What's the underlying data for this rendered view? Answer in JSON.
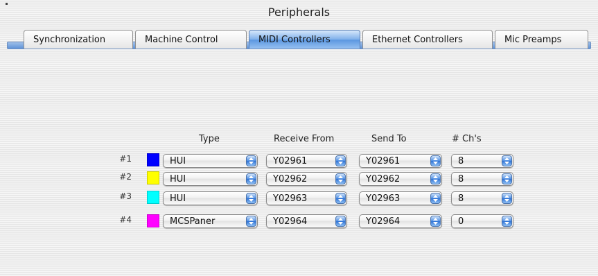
{
  "window": {
    "title": "Peripherals"
  },
  "tabs": [
    {
      "label": "Synchronization",
      "selected": false
    },
    {
      "label": "Machine Control",
      "selected": false
    },
    {
      "label": "MIDI Controllers",
      "selected": true
    },
    {
      "label": "Ethernet Controllers",
      "selected": false
    },
    {
      "label": "Mic Preamps",
      "selected": false
    }
  ],
  "columns": {
    "type": "Type",
    "receive_from": "Receive From",
    "send_to": "Send To",
    "channels": "# Ch's"
  },
  "rows": [
    {
      "label": "#1",
      "color": "#0000ff",
      "type": "HUI",
      "receive_from": "Y02961",
      "send_to": "Y02961",
      "channels": "8"
    },
    {
      "label": "#2",
      "color": "#ffff00",
      "type": "HUI",
      "receive_from": "Y02962",
      "send_to": "Y02962",
      "channels": "8"
    },
    {
      "label": "#3",
      "color": "#00ffff",
      "type": "HUI",
      "receive_from": "Y02963",
      "send_to": "Y02963",
      "channels": "8"
    },
    {
      "label": "#4",
      "color": "#ff00ff",
      "type": "MCSPaner",
      "receive_from": "Y02964",
      "send_to": "Y02964",
      "channels": "0"
    }
  ],
  "icons": {
    "stepper": "up-down-arrows-icon",
    "corner": "window-corner-icon"
  },
  "accent": "#5b97e0"
}
